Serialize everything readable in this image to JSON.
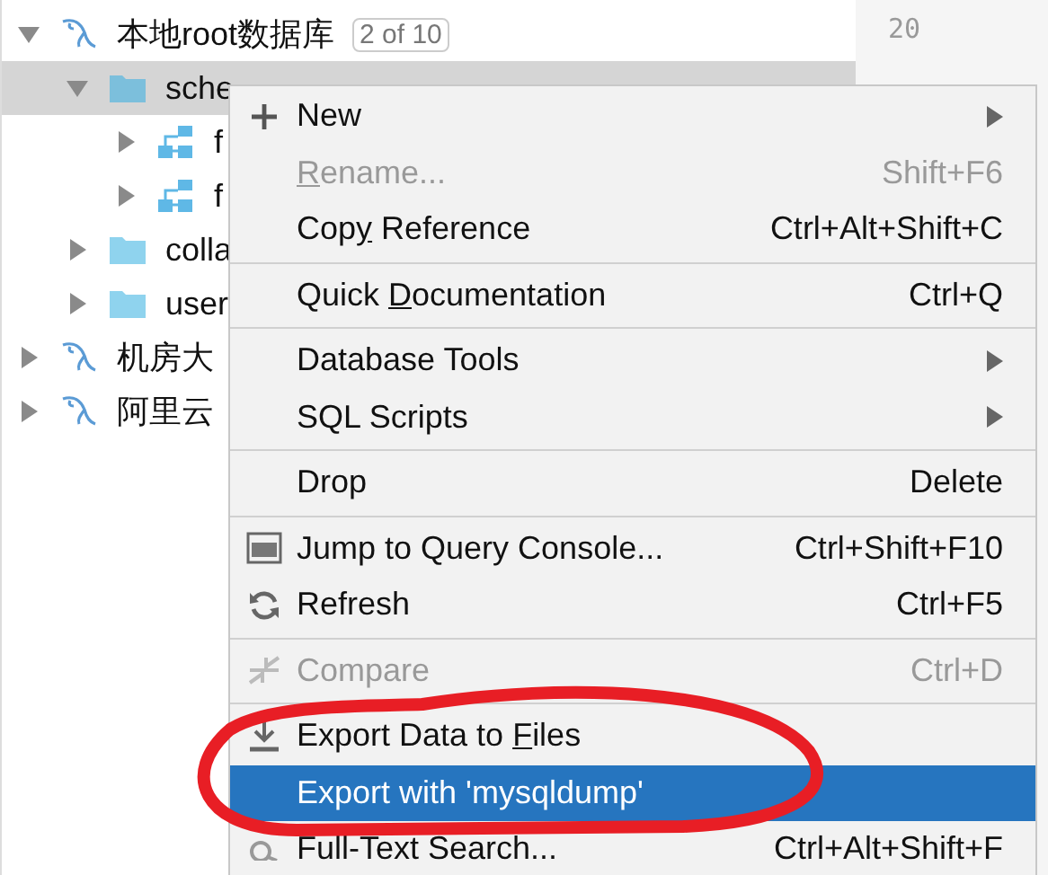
{
  "tree": [
    {
      "label": "本地root数据库",
      "kind": "connection",
      "expanded": true,
      "badge": "2 of 10",
      "selected": false,
      "children": [
        {
          "label": "sche",
          "kind": "folder",
          "expanded": true,
          "selected": true,
          "children": [
            {
              "label": "f",
              "kind": "schema",
              "expanded": false,
              "selected": false
            },
            {
              "label": "f",
              "kind": "schema",
              "expanded": false,
              "selected": false
            }
          ]
        },
        {
          "label": "colla",
          "kind": "folder",
          "expanded": false,
          "selected": false
        },
        {
          "label": "user",
          "kind": "folder",
          "expanded": false,
          "selected": false
        }
      ]
    },
    {
      "label": "机房大",
      "kind": "connection",
      "expanded": false,
      "selected": false
    },
    {
      "label": "阿里云",
      "kind": "connection",
      "expanded": false,
      "selected": false
    }
  ],
  "gutter": {
    "line_numbers": [
      "20"
    ]
  },
  "context_menu": [
    {
      "kind": "plus",
      "label": "New",
      "submenu": true,
      "disabled": false,
      "selected": false
    },
    {
      "kind": "plain",
      "underlined": "R",
      "label_end": "ename...",
      "shortcut": "Shift+F6",
      "submenu": false,
      "disabled": true,
      "selected": false
    },
    {
      "kind": "plain",
      "label": "Cop",
      "underlined": "y",
      "label_end": " Reference",
      "shortcut": "Ctrl+Alt+Shift+C",
      "submenu": false,
      "disabled": false,
      "selected": false
    },
    {
      "kind": "separator"
    },
    {
      "kind": "plain",
      "label": "Quick ",
      "underlined": "D",
      "label_end": "ocumentation",
      "shortcut": "Ctrl+Q",
      "submenu": false,
      "disabled": false,
      "selected": false
    },
    {
      "kind": "separator"
    },
    {
      "kind": "plain",
      "label": "Database Tools",
      "submenu": true,
      "disabled": false,
      "selected": false
    },
    {
      "kind": "plain",
      "label": "SQL Scripts",
      "submenu": true,
      "disabled": false,
      "selected": false
    },
    {
      "kind": "separator"
    },
    {
      "kind": "plain",
      "label": "Drop",
      "shortcut": "Delete",
      "submenu": false,
      "disabled": false,
      "selected": false
    },
    {
      "kind": "separator"
    },
    {
      "kind": "console",
      "label": "Jump to Query Console...",
      "shortcut": "Ctrl+Shift+F10",
      "submenu": false,
      "disabled": false,
      "selected": false
    },
    {
      "kind": "refresh",
      "label": "Refresh",
      "shortcut": "Ctrl+F5",
      "submenu": false,
      "disabled": false,
      "selected": false
    },
    {
      "kind": "separator"
    },
    {
      "kind": "compare",
      "label": "Compare",
      "shortcut": "Ctrl+D",
      "submenu": false,
      "disabled": true,
      "selected": false
    },
    {
      "kind": "separator"
    },
    {
      "kind": "download",
      "label": "Export Data to ",
      "underlined": "F",
      "label_end": "iles",
      "submenu": false,
      "disabled": false,
      "selected": false
    },
    {
      "kind": "plain",
      "label": "Export with 'mysqldump'",
      "submenu": false,
      "disabled": false,
      "selected": true
    },
    {
      "kind": "search",
      "label": "Full-Text Search...",
      "shortcut": "Ctrl+Alt+Shift+F",
      "submenu": false,
      "disabled": false,
      "selected": false
    }
  ]
}
